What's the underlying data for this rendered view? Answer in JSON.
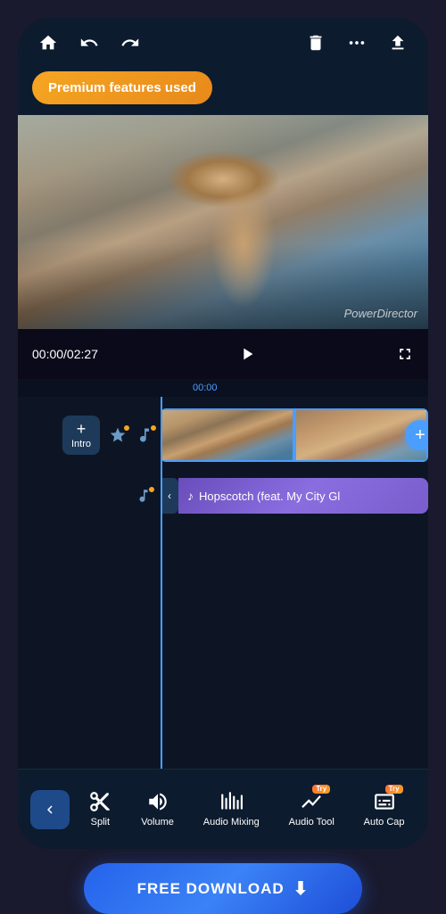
{
  "app": {
    "title": "PowerDirector"
  },
  "topbar": {
    "home_label": "Home",
    "back_label": "Back",
    "forward_label": "Forward",
    "delete_label": "Delete",
    "more_label": "More options",
    "export_label": "Export"
  },
  "premium": {
    "badge_label": "Premium features used"
  },
  "video": {
    "watermark": "PowerDirector"
  },
  "playback": {
    "current_time": "00:00",
    "total_time": "02:27",
    "time_display": "00:00/02:27",
    "timeline_marker": "00:00"
  },
  "timeline": {
    "add_intro_label": "Intro",
    "audio_clip_title": "Hopscotch (feat. My City Gl"
  },
  "toolbar": {
    "back_label": "‹",
    "items": [
      {
        "id": "split",
        "label": "Split",
        "icon": "scissors"
      },
      {
        "id": "volume",
        "label": "Volume",
        "icon": "volume"
      },
      {
        "id": "audio_mixing",
        "label": "Audio Mixing",
        "icon": "mixing"
      },
      {
        "id": "audio_tool",
        "label": "Audio Tool",
        "icon": "audio_tool",
        "has_try": true
      },
      {
        "id": "auto_cap",
        "label": "Auto Cap",
        "icon": "caption",
        "has_try": true
      }
    ]
  },
  "download": {
    "button_label": "FREE DOWNLOAD"
  }
}
